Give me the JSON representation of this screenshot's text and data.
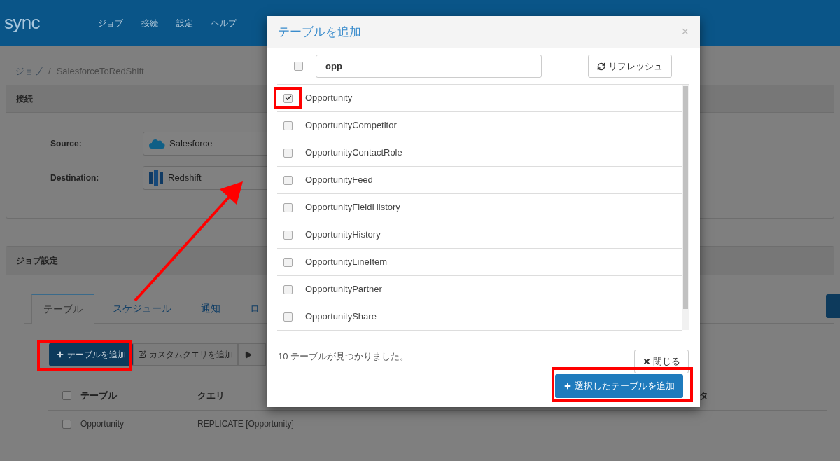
{
  "navbar": {
    "logo": "sync",
    "items": [
      "ジョブ",
      "接続",
      "設定",
      "ヘルプ"
    ]
  },
  "breadcrumb": [
    "ジョブ",
    "/",
    "SalesforceToRedShift"
  ],
  "connection_panel": {
    "title": "接続",
    "fields": [
      {
        "label": "Source:",
        "value": "Salesforce",
        "kind": "cloud"
      },
      {
        "label": "Destination:",
        "value": "Redshift",
        "kind": "database"
      }
    ]
  },
  "job_settings_panel": {
    "title": "ジョブ設定",
    "tabs": [
      {
        "label": "テーブル",
        "selected": true
      },
      {
        "label": "スケジュール",
        "selected": false
      },
      {
        "label": "通知",
        "selected": false
      },
      {
        "label": "ロ",
        "selected": false
      }
    ],
    "buttons": [
      {
        "label": "テーブルを追加",
        "kind": "primary"
      },
      {
        "label": "カスタムクエリを追加",
        "kind": "edit"
      },
      {
        "kind": "run"
      }
    ],
    "table": {
      "select_all": {
        "checked": false
      },
      "columns": [
        "テーブル",
        "クエリ",
        "タ"
      ],
      "rows": [
        {
          "checked": false,
          "table": "Opportunity",
          "query": "REPLICATE [Opportunity]"
        }
      ]
    }
  },
  "modal": {
    "title": "テーブルを追加",
    "close": "×",
    "select_all": {
      "checked": false
    },
    "search": {
      "value": "opp"
    },
    "refresh_button": "リフレッシュ",
    "items": [
      {
        "name": "Opportunity",
        "checked": true
      },
      {
        "name": "OpportunityCompetitor",
        "checked": false
      },
      {
        "name": "OpportunityContactRole",
        "checked": false
      },
      {
        "name": "OpportunityFeed",
        "checked": false
      },
      {
        "name": "OpportunityFieldHistory",
        "checked": false
      },
      {
        "name": "OpportunityHistory",
        "checked": false
      },
      {
        "name": "OpportunityLineItem",
        "checked": false
      },
      {
        "name": "OpportunityPartner",
        "checked": false
      },
      {
        "name": "OpportunityShare",
        "checked": false
      }
    ],
    "status": "10 テーブルが見つかりました。",
    "close_button": "閉じる",
    "add_button": "選択したテーブルを追加"
  }
}
